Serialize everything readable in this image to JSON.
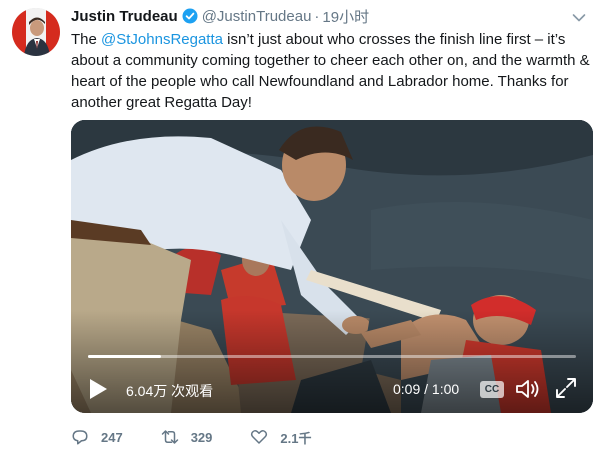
{
  "tweet": {
    "author_name": "Justin Trudeau",
    "handle": "@JustinTrudeau",
    "separator": "·",
    "time": "19小时",
    "text_before": "The ",
    "mention": "@StJohnsRegatta",
    "text_after": " isn’t just about who crosses the finish line first – it’s about a community coming together to cheer each other on, and the warmth & heart of the people who call Newfoundland and Labrador home. Thanks for another great Regatta Day!"
  },
  "video": {
    "views": "6.04万 次观看",
    "timecode": "0:09 / 1:00",
    "cc_label": "CC",
    "progress": 0.15
  },
  "actions": {
    "replies": "247",
    "retweets": "329",
    "likes": "2.1千"
  },
  "colors": {
    "link": "#1b95e0",
    "muted": "#657786",
    "verified": "#1da1f2"
  },
  "icons": {
    "verified": "verified-badge-icon",
    "caret": "chevron-down-icon",
    "play": "play-icon",
    "volume": "volume-icon",
    "fullscreen": "fullscreen-icon",
    "reply": "reply-icon",
    "retweet": "retweet-icon",
    "like": "heart-icon"
  }
}
